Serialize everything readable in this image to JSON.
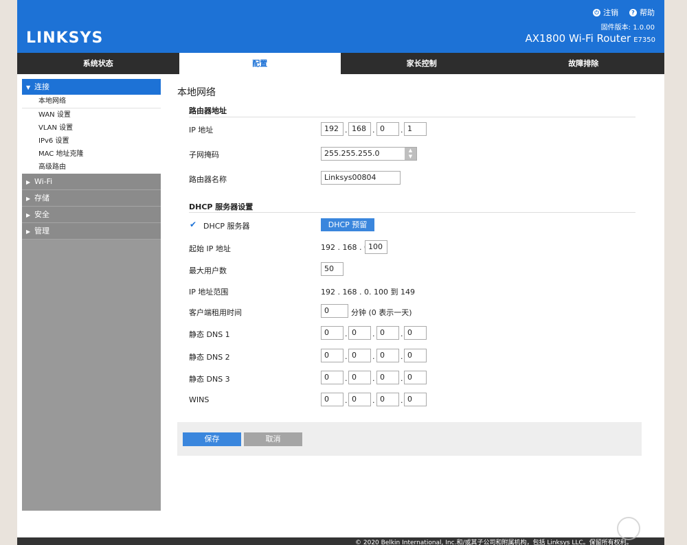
{
  "header": {
    "logo": "LINKSYS",
    "logout_label": "注销",
    "help_label": "帮助",
    "firmware": "固件版本: 1.0.00",
    "product": "AX1800 Wi-Fi Router",
    "model": "E7350"
  },
  "tabs": [
    "系统状态",
    "配置",
    "家长控制",
    "故障排除"
  ],
  "sidebar": {
    "connect": "连接",
    "sub_items": [
      "本地网络",
      "WAN 设置",
      "VLAN 设置",
      "IPv6 设置",
      "MAC 地址克隆",
      "高级路由"
    ],
    "wifi": "Wi-Fi",
    "storage": "存储",
    "security": "安全",
    "admin": "管理"
  },
  "main": {
    "title": "本地网络",
    "router_section": "路由器地址",
    "ip_label": "IP 地址",
    "ip": [
      "192",
      "168",
      "0",
      "1"
    ],
    "mask_label": "子网掩码",
    "mask_value": "255.255.255.0",
    "name_label": "路由器名称",
    "name_value": "Linksys00804",
    "dhcp_section": "DHCP 服务器设置",
    "dhcp_server_label": "DHCP 服务器",
    "dhcp_reserve_button": "DHCP 预留",
    "start_ip_label": "起始 IP 地址",
    "start_ip_prefix": "192 . 168 . 0.",
    "start_ip_last": "100",
    "max_users_label": "最大用户数",
    "max_users": "50",
    "ip_range_label": "IP 地址范围",
    "ip_range_value": "192 . 168 . 0. 100 到 149",
    "lease_label": "客户端租用时间",
    "lease_value": "0",
    "lease_unit": "分钟 (0 表示一天)",
    "dns1_label": "静态 DNS 1",
    "dns1": [
      "0",
      "0",
      "0",
      "0"
    ],
    "dns2_label": "静态 DNS 2",
    "dns2": [
      "0",
      "0",
      "0",
      "0"
    ],
    "dns3_label": "静态 DNS 3",
    "dns3": [
      "0",
      "0",
      "0",
      "0"
    ],
    "wins_label": "WINS",
    "wins": [
      "0",
      "0",
      "0",
      "0"
    ],
    "save_button": "保存",
    "cancel_button": "取消"
  },
  "footer": "© 2020 Belkin International, Inc.和/或其子公司和附属机构，包括 Linksys LLC。保留所有权利。",
  "colors": {
    "brand_blue": "#1d72d6",
    "tab_dark": "#2d2d2d",
    "sidebar_gray": "#999999"
  }
}
